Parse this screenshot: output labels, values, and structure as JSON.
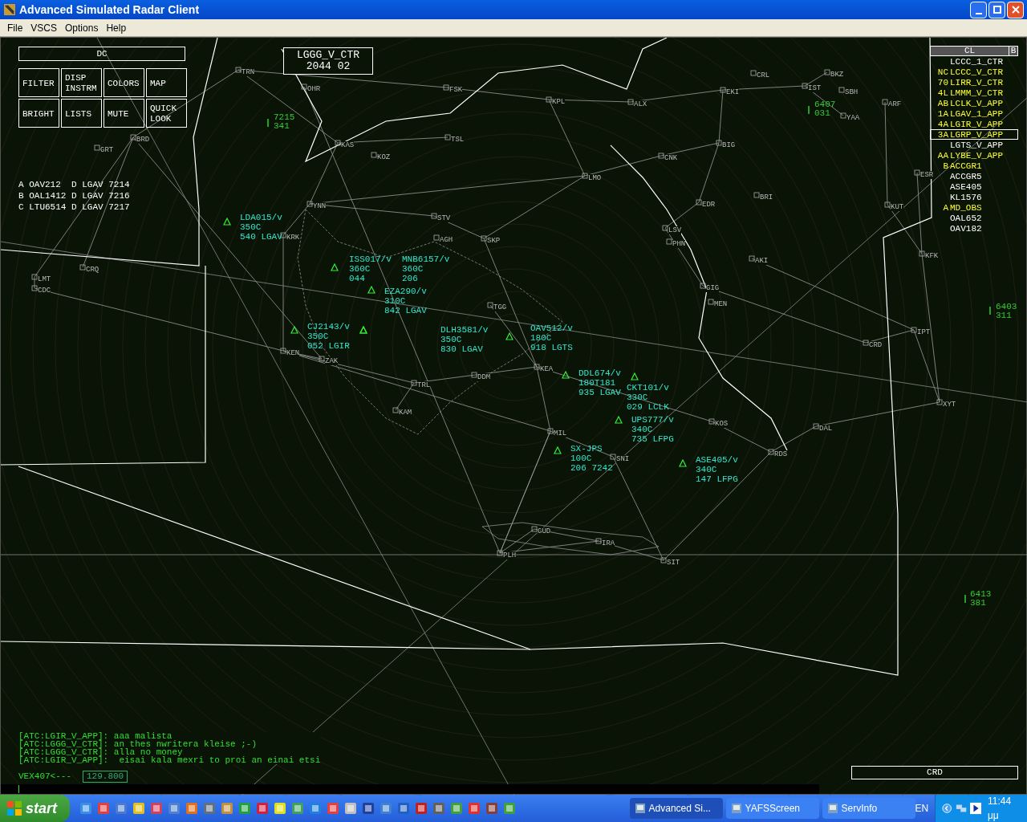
{
  "window": {
    "title": "Advanced Simulated Radar Client"
  },
  "menu": [
    "File",
    "VSCS",
    "Options",
    "Help"
  ],
  "dcb": {
    "title": "DC",
    "buttons": [
      {
        "label": "FILTER"
      },
      {
        "label": "DISP\nINSTRM"
      },
      {
        "label": "COLORS"
      },
      {
        "label": "MAP"
      },
      {
        "label": "BRIGHT"
      },
      {
        "label": "LISTS"
      },
      {
        "label": "MUTE"
      },
      {
        "label": "QUICK\nLOOK"
      }
    ]
  },
  "sector": {
    "name": "LGGG_V_CTR",
    "time": "2044 02"
  },
  "departure_list": [
    {
      "letter": "A",
      "callsign": "OAV212",
      "type": "D",
      "airport": "LGAV",
      "code": "7214"
    },
    {
      "letter": "B",
      "callsign": "OAL1412",
      "type": "D",
      "airport": "LGAV",
      "code": "7216"
    },
    {
      "letter": "C",
      "callsign": "LTU6514",
      "type": "D",
      "airport": "LGAV",
      "code": "7217"
    }
  ],
  "controller_list": {
    "title": "CL",
    "tag": "B",
    "items": [
      {
        "name": "LCCC_1_CTR",
        "color": "#ffffff",
        "selected": false
      },
      {
        "prefix": "NC",
        "name": "LCCC_V_CTR",
        "color": "#ffff33",
        "selected": false
      },
      {
        "prefix": "70",
        "name": "LIRR_V_CTR",
        "color": "#ffff33",
        "selected": false
      },
      {
        "prefix": "4L",
        "name": "LMMM_V_CTR",
        "color": "#ffff33",
        "selected": false
      },
      {
        "prefix": "AB",
        "name": "LCLK_V_APP",
        "color": "#ffff33",
        "selected": false
      },
      {
        "prefix": "1A",
        "name": "LGAV_1_APP",
        "color": "#ffff33",
        "selected": false
      },
      {
        "prefix": "4A",
        "name": "LGIR_V_APP",
        "color": "#ffff33",
        "selected": false
      },
      {
        "prefix": "3A",
        "name": "LGRP_V_APP",
        "color": "#ffff33",
        "selected": true
      },
      {
        "name": "LGTS_V_APP",
        "color": "#ffffff",
        "selected": false
      },
      {
        "prefix": "AA",
        "name": "LYBE_V_APP",
        "color": "#ffff33",
        "selected": false
      },
      {
        "prefix": "B",
        "name": "ACCGR1",
        "color": "#ffff33",
        "selected": false
      },
      {
        "name": "ACCGR5",
        "color": "#ffffff",
        "selected": false
      },
      {
        "name": "ASE405",
        "color": "#ffffff",
        "selected": false
      },
      {
        "name": "KL1576",
        "color": "#ffffff",
        "selected": false
      },
      {
        "prefix": "A",
        "name": "MD_OBS",
        "color": "#ffff33",
        "selected": false
      },
      {
        "name": "OAL652",
        "color": "#ffffff",
        "selected": false
      },
      {
        "name": "OAV182",
        "color": "#ffffff",
        "selected": false
      }
    ]
  },
  "fixes": [
    "TRN",
    "OHR",
    "BRD",
    "GRT",
    "KAS",
    "KOZ",
    "YNN",
    "FSK",
    "KPL",
    "ALX",
    "EKI",
    "CRL",
    "IST",
    "BKZ",
    "SBH",
    "ARF",
    "YAA",
    "BIG",
    "CNK",
    "LMO",
    "EDR",
    "BRI",
    "KUT",
    "ESR",
    "LSV",
    "PHN",
    "AKI",
    "KFK",
    "GIG",
    "MEN",
    "IPT",
    "CRD",
    "ZAK",
    "KEA",
    "TRL",
    "KAM",
    "MIL",
    "SNI",
    "KOS",
    "DAL",
    "XYT",
    "RDS",
    "GUD",
    "IRA",
    "PLH",
    "SIT",
    "LMT",
    "CDC",
    "CRQ",
    "STV",
    "AGH",
    "SKP",
    "KRK",
    "TGG",
    "KEN",
    "DDM",
    "TSL"
  ],
  "aircraft": [
    {
      "lines": [
        "LDA015/v",
        "350C",
        "540 LGAV"
      ]
    },
    {
      "lines": [
        "ISS017/v",
        "360C",
        "044"
      ]
    },
    {
      "lines": [
        "MNB6157/v",
        "360C",
        "206"
      ]
    },
    {
      "lines": [
        "EZA290/v",
        "310C",
        "842 LGAV"
      ]
    },
    {
      "lines": [
        "CJ2143/v",
        "350C",
        "052 LGIR"
      ]
    },
    {
      "lines": [
        "DLH3581/v",
        "350C",
        "830 LGAV"
      ]
    },
    {
      "lines": [
        "OAV512/v",
        "180C",
        "918 LGTS"
      ]
    },
    {
      "lines": [
        "DDL674/v",
        "180T181",
        "935 LGAV"
      ]
    },
    {
      "lines": [
        "CKT101/v",
        "330C",
        "029 LCLK"
      ]
    },
    {
      "lines": [
        "UPS777/v",
        "340C",
        "735 LFPG"
      ]
    },
    {
      "lines": [
        "SX-JPS",
        "100C",
        "206 7242"
      ]
    },
    {
      "lines": [
        "ASE405/v",
        "340C",
        "147 LFPG"
      ]
    }
  ],
  "unidentified_targets": [
    {
      "code": "7215",
      "level": "341"
    },
    {
      "code": "6407",
      "level": "031"
    },
    {
      "code": "6403",
      "level": "311"
    },
    {
      "code": "6413",
      "level": "381"
    }
  ],
  "messages": [
    "[ATC:LGIR_V_APP]: aaa malista",
    "[ATC:LGGG_V_CTR]: an thes nwritera kleise ;-)",
    "[ATC:LGGG_V_CTR]: alla no money",
    "[ATC:LGIR_V_APP]:  eisai kala mexri to proi an einai etsi"
  ],
  "command": {
    "callsign": "VEX407<---",
    "frequency": "129.800"
  },
  "crd_box": "CRD",
  "taskbar": {
    "start": "start",
    "tasks": [
      {
        "label": "Advanced Si...",
        "selected": true
      },
      {
        "label": "YAFSScreen",
        "selected": false
      },
      {
        "label": "ServInfo",
        "selected": false
      }
    ],
    "language": "EN",
    "clock": "11:44 μμ"
  }
}
